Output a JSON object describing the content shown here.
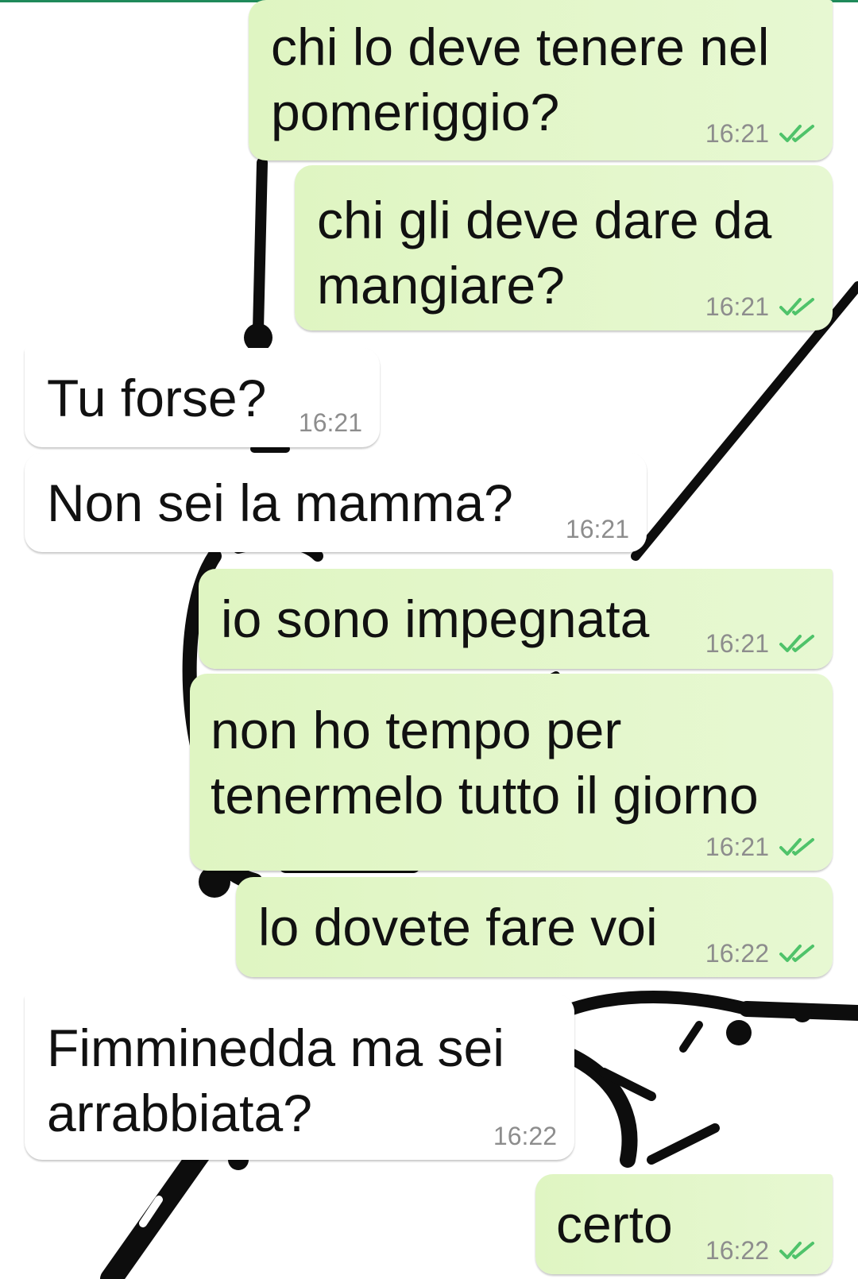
{
  "theme": {
    "outgoing_bubble": "#e3f7cc",
    "incoming_bubble": "#ffffff",
    "read_check": "#4fc36a",
    "time_text": "#8d8d8d"
  },
  "messages": [
    {
      "id": "m1",
      "direction": "out",
      "text": "chi lo deve tenere nel\npomeriggio?",
      "time": "16:21",
      "status_icon": "double-check-icon"
    },
    {
      "id": "m2",
      "direction": "out",
      "text": "chi gli deve dare da\nmangiare?",
      "time": "16:21",
      "status_icon": "double-check-icon"
    },
    {
      "id": "m3",
      "direction": "in",
      "text": "Tu forse?",
      "time": "16:21"
    },
    {
      "id": "m4",
      "direction": "in",
      "text": "Non sei la mamma?",
      "time": "16:21"
    },
    {
      "id": "m5",
      "direction": "out",
      "text": "io sono impegnata",
      "time": "16:21",
      "status_icon": "double-check-icon"
    },
    {
      "id": "m6",
      "direction": "out",
      "text": "non ho tempo per\ntenermelo tutto il giorno",
      "time": "16:21",
      "status_icon": "double-check-icon"
    },
    {
      "id": "m7",
      "direction": "out",
      "text": "lo dovete fare voi",
      "time": "16:22",
      "status_icon": "double-check-icon"
    },
    {
      "id": "m8",
      "direction": "in",
      "text": "Fimminedda ma sei\narrabbiata?",
      "time": "16:22"
    },
    {
      "id": "m9",
      "direction": "out",
      "text": "certo",
      "time": "16:22",
      "status_icon": "double-check-icon"
    }
  ]
}
